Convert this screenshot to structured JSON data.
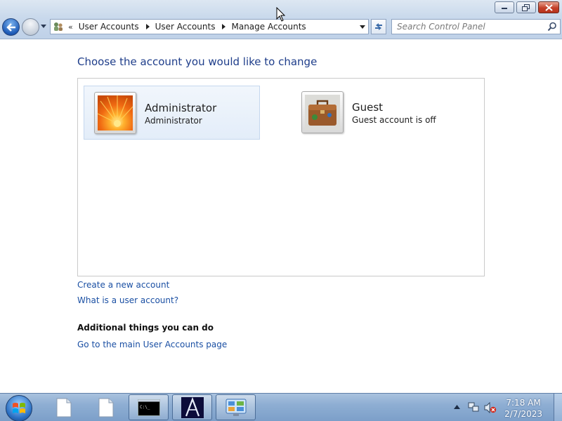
{
  "window": {
    "controls": {
      "minimize": "minimize",
      "restore": "restore",
      "close": "close"
    }
  },
  "nav": {
    "back_icon": "back-arrow-icon",
    "forward_icon": "forward-arrow-icon"
  },
  "address_bar": {
    "overflow": "«",
    "breadcrumbs": [
      "User Accounts",
      "User Accounts",
      "Manage Accounts"
    ]
  },
  "search": {
    "placeholder": "Search Control Panel"
  },
  "main": {
    "heading": "Choose the account you would like to change",
    "accounts": [
      {
        "name": "Administrator",
        "detail": "Administrator",
        "picture": "orange-flower-picture",
        "selected": true
      },
      {
        "name": "Guest",
        "detail": "Guest account is off",
        "picture": "briefcase-picture",
        "selected": false
      }
    ],
    "links": {
      "create_account": "Create a new account",
      "what_is": "What is a user account?"
    },
    "additional": {
      "title": "Additional things you can do",
      "main_page": "Go to the main User Accounts page"
    }
  },
  "taskbar": {
    "items": [
      "document-icon",
      "document-icon",
      "command-prompt-icon",
      "app-a-icon",
      "control-panel-icon"
    ],
    "clock": {
      "time": "7:18 AM",
      "date": "2/7/2023"
    }
  },
  "colors": {
    "accent": "#1e3d8a",
    "link": "#1a4fa3"
  }
}
